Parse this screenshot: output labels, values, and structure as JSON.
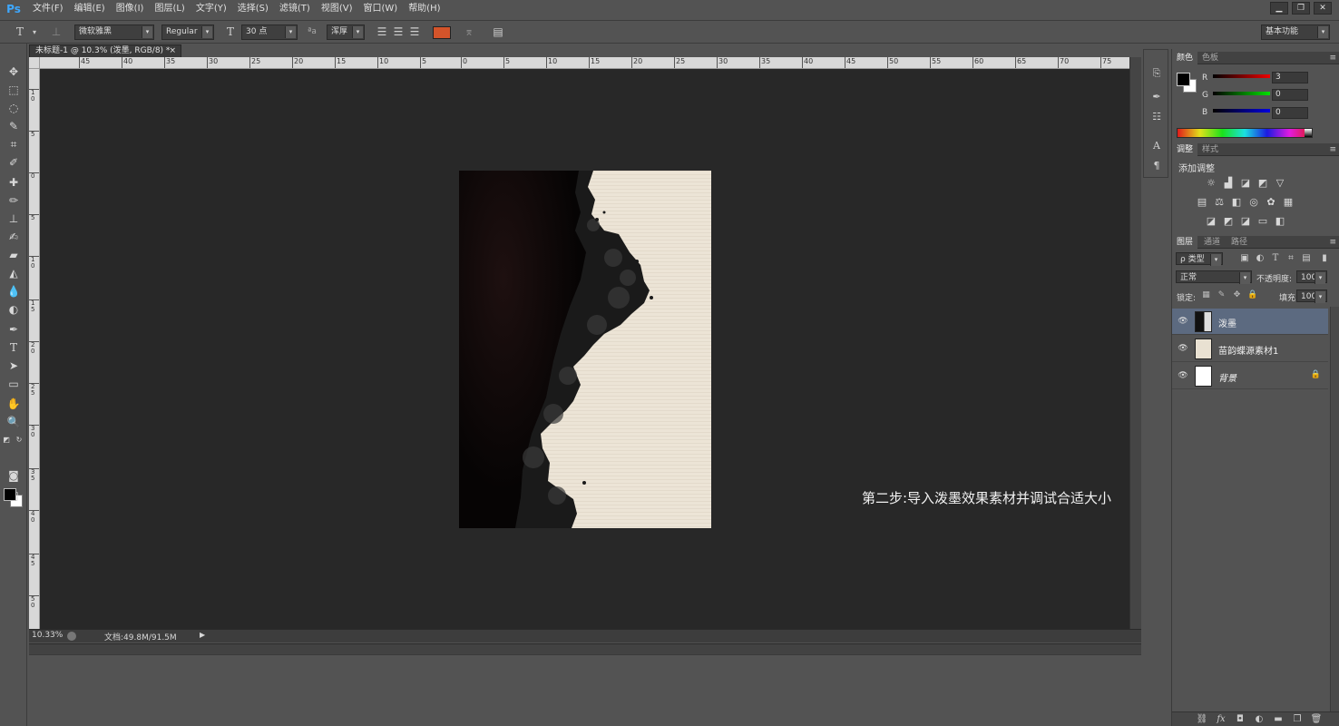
{
  "app": {
    "logo": "Ps",
    "menus": [
      "文件(F)",
      "编辑(E)",
      "图像(I)",
      "图层(L)",
      "文字(Y)",
      "选择(S)",
      "滤镜(T)",
      "视图(V)",
      "窗口(W)",
      "帮助(H)"
    ],
    "window_controls": [
      "▁",
      "❐",
      "✕"
    ]
  },
  "options": {
    "font_family": "微软雅黑",
    "font_style": "Regular",
    "font_size": "30 点",
    "antialias": "浑厚",
    "text_color": "#d4542a",
    "workspace": "基本功能"
  },
  "document": {
    "tab_title": "未标题-1 @ 10.3% (泼墨, RGB/8) *",
    "tab_close": "×",
    "ruler_h_labels": [
      "45",
      "40",
      "35",
      "30",
      "25",
      "20",
      "15",
      "10",
      "5",
      "0",
      "5",
      "10",
      "15",
      "20",
      "25",
      "30",
      "35",
      "40",
      "45",
      "50",
      "55",
      "60",
      "65",
      "70",
      "75"
    ],
    "ruler_v_labels": [
      "1\n0",
      "5",
      "0",
      "5",
      "1\n0",
      "1\n5",
      "2\n0",
      "2\n5",
      "3\n0",
      "3\n5",
      "4\n0",
      "4\n5",
      "5\n0"
    ],
    "caption": "第二步:导入泼墨效果素材并调试合适大小",
    "zoom": "10.33%",
    "doc_size": "文档:49.8M/91.5M",
    "status_arrow": "▶"
  },
  "panels": {
    "color": {
      "tabs": [
        "颜色",
        "色板"
      ],
      "channels": [
        {
          "label": "R",
          "value": "3"
        },
        {
          "label": "G",
          "value": "0"
        },
        {
          "label": "B",
          "value": "0"
        }
      ]
    },
    "adjustments": {
      "tabs": [
        "调整",
        "样式"
      ],
      "title": "添加调整"
    },
    "layers": {
      "tabs": [
        "图层",
        "通道",
        "路径"
      ],
      "filter_label": "ρ 类型",
      "blend_mode": "正常",
      "opacity_label": "不透明度:",
      "opacity": "100%",
      "lock_label": "锁定:",
      "fill_label": "填充:",
      "fill": "100%",
      "items": [
        {
          "name": "泼墨",
          "selected": true
        },
        {
          "name": "苗韵蝶源素材1",
          "selected": false
        },
        {
          "name": "背景",
          "selected": false,
          "locked": true
        }
      ]
    },
    "panel_menu": "≡"
  }
}
